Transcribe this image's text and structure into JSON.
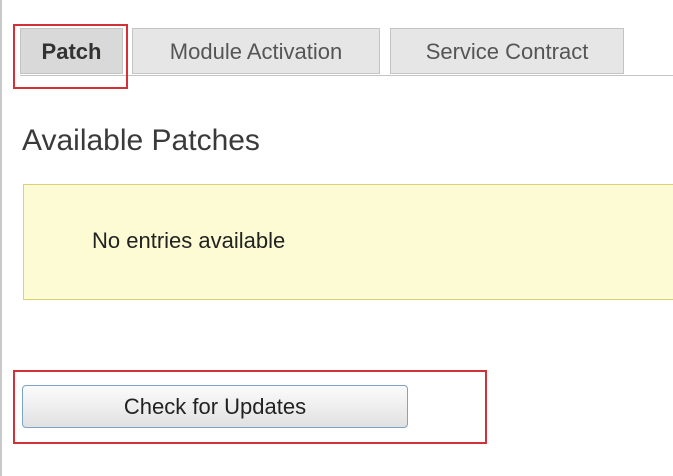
{
  "tabs": [
    {
      "label": "Patch",
      "active": true
    },
    {
      "label": "Module Activation",
      "active": false
    },
    {
      "label": "Service Contract",
      "active": false
    }
  ],
  "section": {
    "heading": "Available Patches",
    "empty_message": "No entries available"
  },
  "actions": {
    "check_updates_label": "Check for Updates"
  },
  "colors": {
    "highlight": "#d2313a",
    "notice_background": "#fdfbd3",
    "notice_border": "#dad27a",
    "button_border": "#7fa3c6"
  }
}
